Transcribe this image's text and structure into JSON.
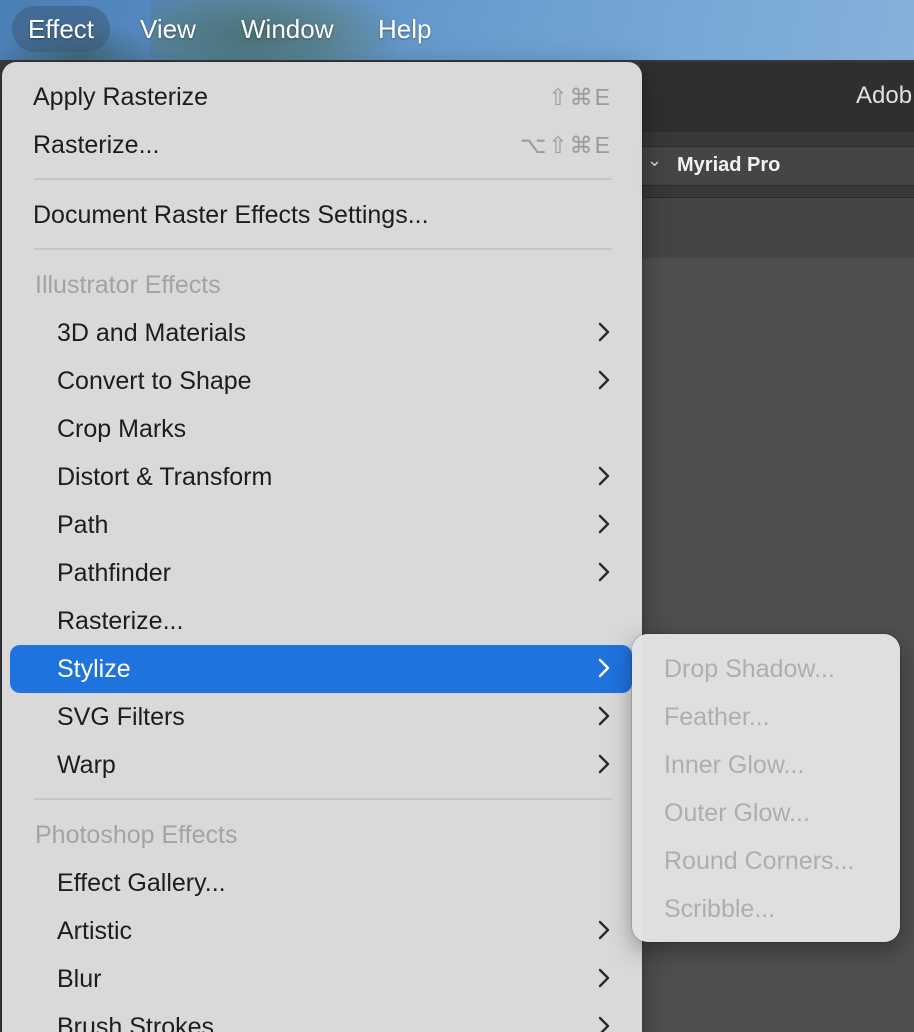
{
  "menubar": {
    "items": [
      {
        "label": "Effect",
        "active": true
      },
      {
        "label": "View",
        "active": false
      },
      {
        "label": "Window",
        "active": false
      },
      {
        "label": "Help",
        "active": false
      }
    ]
  },
  "app": {
    "title": "Adob",
    "font_name": "Myriad Pro"
  },
  "menu": {
    "apply_rasterize": {
      "label": "Apply Rasterize",
      "shortcut": "⇧⌘E"
    },
    "rasterize": {
      "label": "Rasterize...",
      "shortcut": "⌥⇧⌘E"
    },
    "document_raster_settings": {
      "label": "Document Raster Effects Settings..."
    },
    "illustrator_header": "Illustrator Effects",
    "illustrator_items": [
      {
        "label": "3D and Materials",
        "has_submenu": true
      },
      {
        "label": "Convert to Shape",
        "has_submenu": true
      },
      {
        "label": "Crop Marks",
        "has_submenu": false
      },
      {
        "label": "Distort & Transform",
        "has_submenu": true
      },
      {
        "label": "Path",
        "has_submenu": true
      },
      {
        "label": "Pathfinder",
        "has_submenu": true
      },
      {
        "label": "Rasterize...",
        "has_submenu": false
      },
      {
        "label": "Stylize",
        "has_submenu": true,
        "highlighted": true
      },
      {
        "label": "SVG Filters",
        "has_submenu": true
      },
      {
        "label": "Warp",
        "has_submenu": true
      }
    ],
    "photoshop_header": "Photoshop Effects",
    "photoshop_items": [
      {
        "label": "Effect Gallery...",
        "has_submenu": false
      },
      {
        "label": "Artistic",
        "has_submenu": true
      },
      {
        "label": "Blur",
        "has_submenu": true
      },
      {
        "label": "Brush Strokes",
        "has_submenu": true
      }
    ]
  },
  "submenu": {
    "items": [
      {
        "label": "Drop Shadow...",
        "enabled": false
      },
      {
        "label": "Feather...",
        "enabled": false
      },
      {
        "label": "Inner Glow...",
        "enabled": false
      },
      {
        "label": "Outer Glow...",
        "enabled": false
      },
      {
        "label": "Round Corners...",
        "enabled": false
      },
      {
        "label": "Scribble...",
        "enabled": false
      }
    ]
  },
  "colors": {
    "highlight": "#1f73de",
    "disabled_text": "#aeaeae",
    "menu_text": "#1d1d1d"
  }
}
